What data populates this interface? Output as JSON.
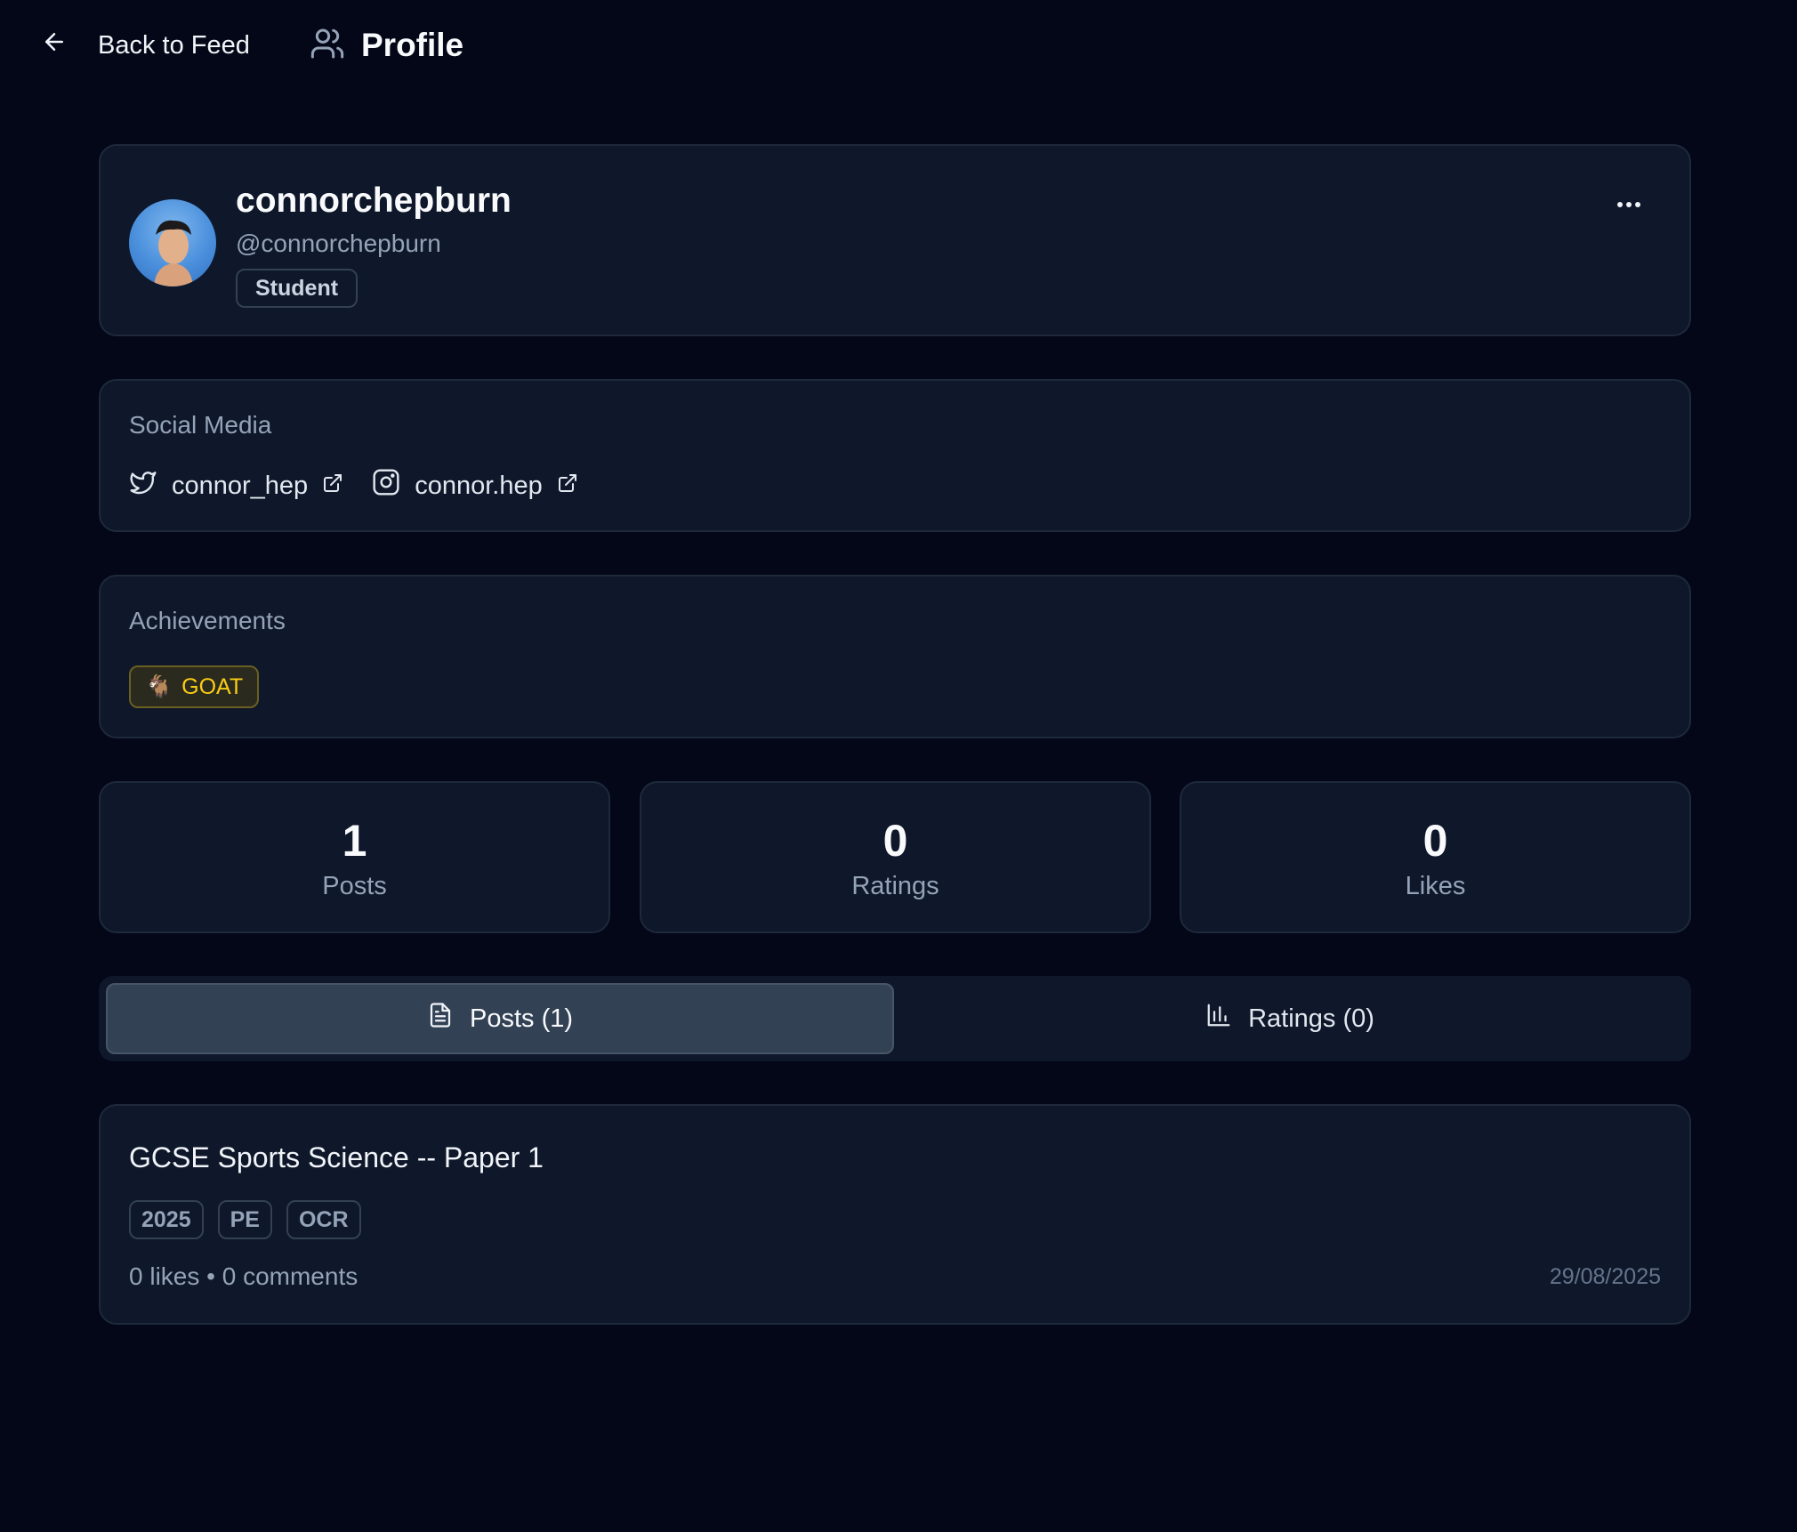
{
  "header": {
    "back_label": "Back to Feed",
    "title": "Profile"
  },
  "profile": {
    "display_name": "connorchepburn",
    "handle": "@connorchepburn",
    "role": "Student"
  },
  "social": {
    "section_label": "Social Media",
    "links": [
      {
        "platform": "twitter",
        "icon": "twitter-icon",
        "label": "connor_hep"
      },
      {
        "platform": "instagram",
        "icon": "instagram-icon",
        "label": "connor.hep"
      }
    ]
  },
  "achievements": {
    "section_label": "Achievements",
    "items": [
      {
        "emoji": "🐐",
        "label": "GOAT"
      }
    ]
  },
  "stats": [
    {
      "value": "1",
      "label": "Posts"
    },
    {
      "value": "0",
      "label": "Ratings"
    },
    {
      "value": "0",
      "label": "Likes"
    }
  ],
  "tabs": [
    {
      "label": "Posts (1)",
      "icon": "document-icon",
      "active": true
    },
    {
      "label": "Ratings (0)",
      "icon": "bar-chart-icon",
      "active": false
    }
  ],
  "posts": [
    {
      "title": "GCSE Sports Science -- Paper 1",
      "tags": [
        "2025",
        "PE",
        "OCR"
      ],
      "meta": "0 likes • 0 comments",
      "date": "29/08/2025"
    }
  ],
  "colors": {
    "background": "#030717",
    "card": "#0f172a",
    "border": "#1e293b",
    "accent_gold": "#facc15",
    "active_tab": "#334155"
  }
}
